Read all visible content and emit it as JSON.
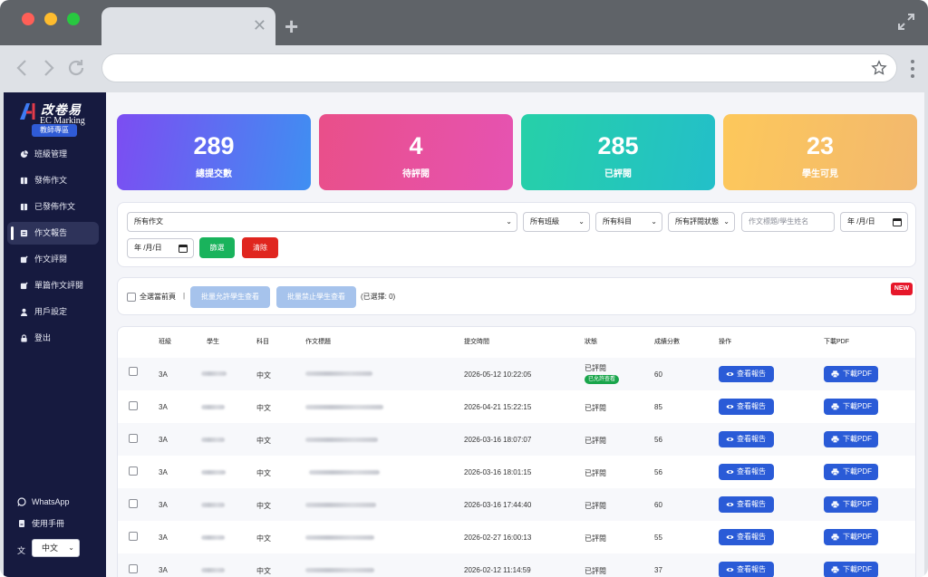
{
  "sidebar": {
    "logo_title": "改卷易",
    "logo_subtitle": "EC Marking",
    "role_badge": "教師專區",
    "items": [
      {
        "label": "班級管理",
        "icon": "pie-chart-icon"
      },
      {
        "label": "發佈作文",
        "icon": "book-icon"
      },
      {
        "label": "已發佈作文",
        "icon": "book-icon"
      },
      {
        "label": "作文報告",
        "icon": "report-icon",
        "active": true
      },
      {
        "label": "作文評閱",
        "icon": "edit-icon"
      },
      {
        "label": "單篇作文評閱",
        "icon": "edit-icon"
      },
      {
        "label": "用戶設定",
        "icon": "user-icon"
      },
      {
        "label": "登出",
        "icon": "lock-icon"
      }
    ],
    "whatsapp": "WhatsApp",
    "manual": "使用手冊",
    "language": "中文"
  },
  "stats": [
    {
      "value": "289",
      "label": "總提交數"
    },
    {
      "value": "4",
      "label": "待評閱"
    },
    {
      "value": "285",
      "label": "已評閱"
    },
    {
      "value": "23",
      "label": "學生可見"
    }
  ],
  "filters": {
    "essay": "所有作文",
    "class": "所有班級",
    "subject": "所有科目",
    "review_status": "所有評閱狀態",
    "search_placeholder": "作文標題/學生姓名",
    "date_from": "年 /月/日",
    "date_to": "年 /月/日",
    "filter_button": "篩選",
    "clear_button": "清除"
  },
  "batch": {
    "select_all": "全選當前頁",
    "separator": "|",
    "allow_button": "批量允許學生查看",
    "forbid_button": "批量禁止學生查看",
    "selected": "(已選擇: 0)",
    "new_badge": "NEW"
  },
  "table": {
    "headers": [
      "班級",
      "學生",
      "科目",
      "作文標題",
      "提交時間",
      "狀態",
      "成績分數",
      "操作",
      "下載PDF"
    ],
    "view_button": "查看報告",
    "pdf_button": "下載PDF",
    "visible_chip": "已允許查看",
    "rows": [
      {
        "class": "3A",
        "subject": "中文",
        "time": "2026-05-12 10:22:05",
        "status": "已評閱",
        "visible": true,
        "score": "60"
      },
      {
        "class": "3A",
        "subject": "中文",
        "time": "2026-04-21 15:22:15",
        "status": "已評閱",
        "visible": false,
        "score": "85"
      },
      {
        "class": "3A",
        "subject": "中文",
        "time": "2026-03-16 18:07:07",
        "status": "已評閱",
        "visible": false,
        "score": "56"
      },
      {
        "class": "3A",
        "subject": "中文",
        "time": "2026-03-16 18:01:15",
        "status": "已評閱",
        "visible": false,
        "score": "56"
      },
      {
        "class": "3A",
        "subject": "中文",
        "time": "2026-03-16 17:44:40",
        "status": "已評閱",
        "visible": false,
        "score": "60"
      },
      {
        "class": "3A",
        "subject": "中文",
        "time": "2026-02-27 16:00:13",
        "status": "已評閱",
        "visible": false,
        "score": "55"
      },
      {
        "class": "3A",
        "subject": "中文",
        "time": "2026-02-12 11:14:59",
        "status": "已評閱",
        "visible": false,
        "score": "37"
      }
    ]
  }
}
